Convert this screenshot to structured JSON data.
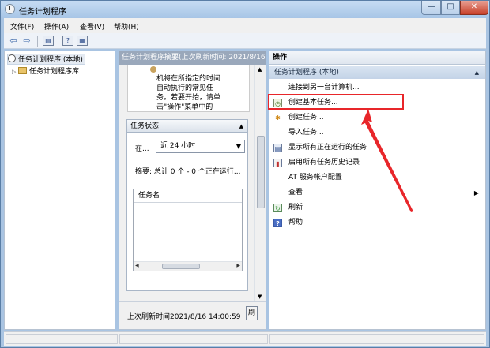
{
  "window": {
    "title": "任务计划程序",
    "controls": {
      "minimize": "—",
      "maximize": "□",
      "close": "✕"
    }
  },
  "menu": [
    "文件(F)",
    "操作(A)",
    "查看(V)",
    "帮助(H)"
  ],
  "toolbar": {
    "back_icon": "⇦",
    "forward_icon": "⇨",
    "help_icon": "?"
  },
  "tree": {
    "root": "任务计划程序 (本地)",
    "child": "任务计划程序库"
  },
  "middle": {
    "header": "任务计划程序摘要(上次刷新时间: 2021/8/16",
    "description_lines": [
      "机将在所指定的时间",
      "自动执行的常见任",
      "务。若要开始，请单",
      "击\"操作\"菜单中的"
    ],
    "task_status": {
      "title": "任务状态",
      "in_label": "在...",
      "period": "近 24 小时",
      "summary": "摘要: 总计 0 个 - 0 个正在运行...",
      "column_header": "任务名"
    },
    "footer": {
      "last_refresh": "上次刷新时间2021/8/16 14:00:59",
      "refresh_button": "刷"
    }
  },
  "actions": {
    "header": "操作",
    "section": "任务计划程序 (本地)",
    "items": [
      {
        "label": "连接到另一台计算机...",
        "icon": ""
      },
      {
        "label": "创建基本任务...",
        "icon": "basic-task-icon"
      },
      {
        "label": "创建任务...",
        "icon": "create-task-icon"
      },
      {
        "label": "导入任务...",
        "icon": ""
      },
      {
        "label": "显示所有正在运行的任务",
        "icon": "running-tasks-icon"
      },
      {
        "label": "启用所有任务历史记录",
        "icon": "history-icon"
      },
      {
        "label": "AT 服务帐户配置",
        "icon": ""
      },
      {
        "label": "查看",
        "icon": ""
      },
      {
        "label": "刷新",
        "icon": "refresh-icon"
      },
      {
        "label": "帮助",
        "icon": "help-icon"
      }
    ]
  },
  "annotation": {
    "color": "#e8262a"
  }
}
